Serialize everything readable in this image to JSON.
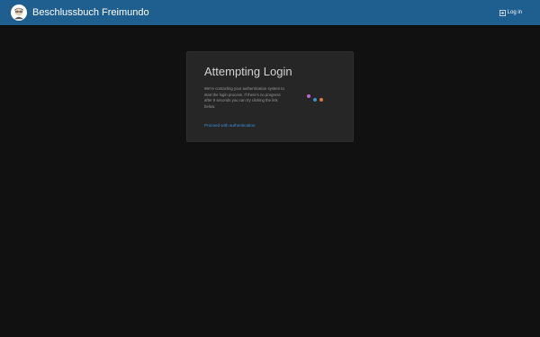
{
  "header": {
    "title": "Beschlussbuch Freimundo",
    "login_label": "Log in",
    "logo_icon": "avatar-logo-icon",
    "login_icon": "login-icon"
  },
  "card": {
    "title": "Attempting Login",
    "message": "We're contacting your authentication system to start the login process. If there's no progress after 9 seconds you can try clicking the link below.",
    "link_label": "Proceed with authentication"
  },
  "loader": {
    "dot_colors": [
      "#c064d8",
      "#3d8fd6",
      "#e07a3a"
    ]
  },
  "colors": {
    "header_bg": "#1f5f8f",
    "page_bg": "#111111",
    "card_bg": "#262626",
    "link": "#3d8fd6"
  }
}
